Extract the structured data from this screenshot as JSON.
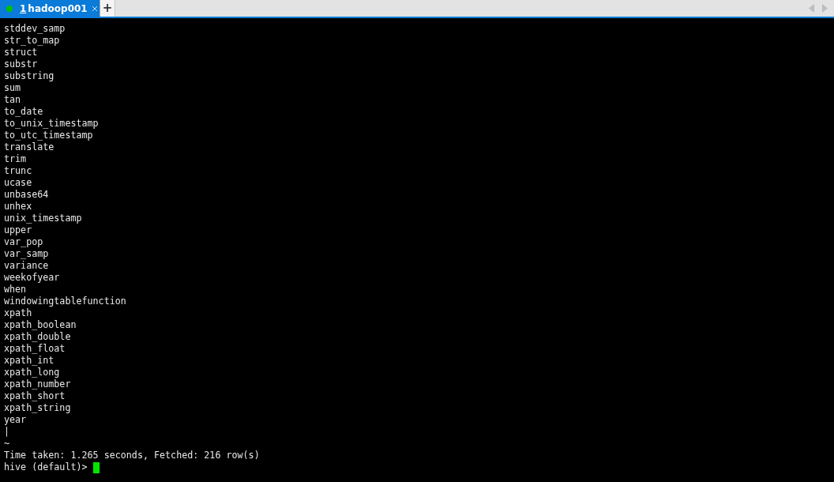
{
  "tabs": [
    {
      "number": "1",
      "label": "hadoop001",
      "selected": true,
      "color": "#00c000"
    }
  ],
  "new_tab": "+",
  "terminal": {
    "lines": [
      "stddev_samp",
      "str_to_map",
      "struct",
      "substr",
      "substring",
      "sum",
      "tan",
      "to_date",
      "to_unix_timestamp",
      "to_utc_timestamp",
      "translate",
      "trim",
      "trunc",
      "ucase",
      "unbase64",
      "unhex",
      "unix_timestamp",
      "upper",
      "var_pop",
      "var_samp",
      "variance",
      "weekofyear",
      "when",
      "windowingtablefunction",
      "xpath",
      "xpath_boolean",
      "xpath_double",
      "xpath_float",
      "xpath_int",
      "xpath_long",
      "xpath_number",
      "xpath_short",
      "xpath_string",
      "year",
      "|",
      "~",
      "Time taken: 1.265 seconds, Fetched: 216 row(s)"
    ],
    "prompt": "hive (default)>"
  }
}
